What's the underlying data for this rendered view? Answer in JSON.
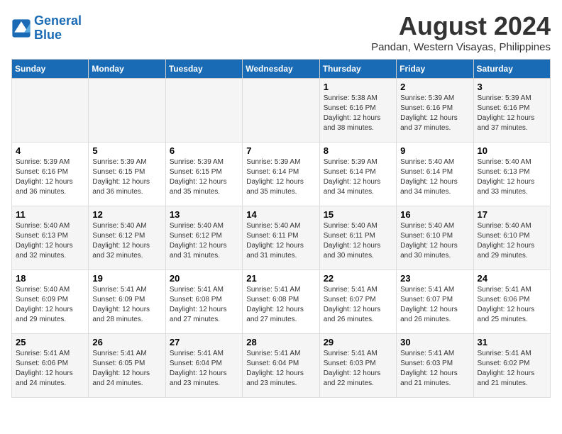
{
  "logo": {
    "line1": "General",
    "line2": "Blue"
  },
  "title": "August 2024",
  "subtitle": "Pandan, Western Visayas, Philippines",
  "headers": [
    "Sunday",
    "Monday",
    "Tuesday",
    "Wednesday",
    "Thursday",
    "Friday",
    "Saturday"
  ],
  "weeks": [
    {
      "days": [
        {
          "number": "",
          "info": ""
        },
        {
          "number": "",
          "info": ""
        },
        {
          "number": "",
          "info": ""
        },
        {
          "number": "",
          "info": ""
        },
        {
          "number": "1",
          "info": "Sunrise: 5:38 AM\nSunset: 6:16 PM\nDaylight: 12 hours\nand 38 minutes."
        },
        {
          "number": "2",
          "info": "Sunrise: 5:39 AM\nSunset: 6:16 PM\nDaylight: 12 hours\nand 37 minutes."
        },
        {
          "number": "3",
          "info": "Sunrise: 5:39 AM\nSunset: 6:16 PM\nDaylight: 12 hours\nand 37 minutes."
        }
      ]
    },
    {
      "days": [
        {
          "number": "4",
          "info": "Sunrise: 5:39 AM\nSunset: 6:16 PM\nDaylight: 12 hours\nand 36 minutes."
        },
        {
          "number": "5",
          "info": "Sunrise: 5:39 AM\nSunset: 6:15 PM\nDaylight: 12 hours\nand 36 minutes."
        },
        {
          "number": "6",
          "info": "Sunrise: 5:39 AM\nSunset: 6:15 PM\nDaylight: 12 hours\nand 35 minutes."
        },
        {
          "number": "7",
          "info": "Sunrise: 5:39 AM\nSunset: 6:14 PM\nDaylight: 12 hours\nand 35 minutes."
        },
        {
          "number": "8",
          "info": "Sunrise: 5:39 AM\nSunset: 6:14 PM\nDaylight: 12 hours\nand 34 minutes."
        },
        {
          "number": "9",
          "info": "Sunrise: 5:40 AM\nSunset: 6:14 PM\nDaylight: 12 hours\nand 34 minutes."
        },
        {
          "number": "10",
          "info": "Sunrise: 5:40 AM\nSunset: 6:13 PM\nDaylight: 12 hours\nand 33 minutes."
        }
      ]
    },
    {
      "days": [
        {
          "number": "11",
          "info": "Sunrise: 5:40 AM\nSunset: 6:13 PM\nDaylight: 12 hours\nand 32 minutes."
        },
        {
          "number": "12",
          "info": "Sunrise: 5:40 AM\nSunset: 6:12 PM\nDaylight: 12 hours\nand 32 minutes."
        },
        {
          "number": "13",
          "info": "Sunrise: 5:40 AM\nSunset: 6:12 PM\nDaylight: 12 hours\nand 31 minutes."
        },
        {
          "number": "14",
          "info": "Sunrise: 5:40 AM\nSunset: 6:11 PM\nDaylight: 12 hours\nand 31 minutes."
        },
        {
          "number": "15",
          "info": "Sunrise: 5:40 AM\nSunset: 6:11 PM\nDaylight: 12 hours\nand 30 minutes."
        },
        {
          "number": "16",
          "info": "Sunrise: 5:40 AM\nSunset: 6:10 PM\nDaylight: 12 hours\nand 30 minutes."
        },
        {
          "number": "17",
          "info": "Sunrise: 5:40 AM\nSunset: 6:10 PM\nDaylight: 12 hours\nand 29 minutes."
        }
      ]
    },
    {
      "days": [
        {
          "number": "18",
          "info": "Sunrise: 5:40 AM\nSunset: 6:09 PM\nDaylight: 12 hours\nand 29 minutes."
        },
        {
          "number": "19",
          "info": "Sunrise: 5:41 AM\nSunset: 6:09 PM\nDaylight: 12 hours\nand 28 minutes."
        },
        {
          "number": "20",
          "info": "Sunrise: 5:41 AM\nSunset: 6:08 PM\nDaylight: 12 hours\nand 27 minutes."
        },
        {
          "number": "21",
          "info": "Sunrise: 5:41 AM\nSunset: 6:08 PM\nDaylight: 12 hours\nand 27 minutes."
        },
        {
          "number": "22",
          "info": "Sunrise: 5:41 AM\nSunset: 6:07 PM\nDaylight: 12 hours\nand 26 minutes."
        },
        {
          "number": "23",
          "info": "Sunrise: 5:41 AM\nSunset: 6:07 PM\nDaylight: 12 hours\nand 26 minutes."
        },
        {
          "number": "24",
          "info": "Sunrise: 5:41 AM\nSunset: 6:06 PM\nDaylight: 12 hours\nand 25 minutes."
        }
      ]
    },
    {
      "days": [
        {
          "number": "25",
          "info": "Sunrise: 5:41 AM\nSunset: 6:06 PM\nDaylight: 12 hours\nand 24 minutes."
        },
        {
          "number": "26",
          "info": "Sunrise: 5:41 AM\nSunset: 6:05 PM\nDaylight: 12 hours\nand 24 minutes."
        },
        {
          "number": "27",
          "info": "Sunrise: 5:41 AM\nSunset: 6:04 PM\nDaylight: 12 hours\nand 23 minutes."
        },
        {
          "number": "28",
          "info": "Sunrise: 5:41 AM\nSunset: 6:04 PM\nDaylight: 12 hours\nand 23 minutes."
        },
        {
          "number": "29",
          "info": "Sunrise: 5:41 AM\nSunset: 6:03 PM\nDaylight: 12 hours\nand 22 minutes."
        },
        {
          "number": "30",
          "info": "Sunrise: 5:41 AM\nSunset: 6:03 PM\nDaylight: 12 hours\nand 21 minutes."
        },
        {
          "number": "31",
          "info": "Sunrise: 5:41 AM\nSunset: 6:02 PM\nDaylight: 12 hours\nand 21 minutes."
        }
      ]
    }
  ]
}
